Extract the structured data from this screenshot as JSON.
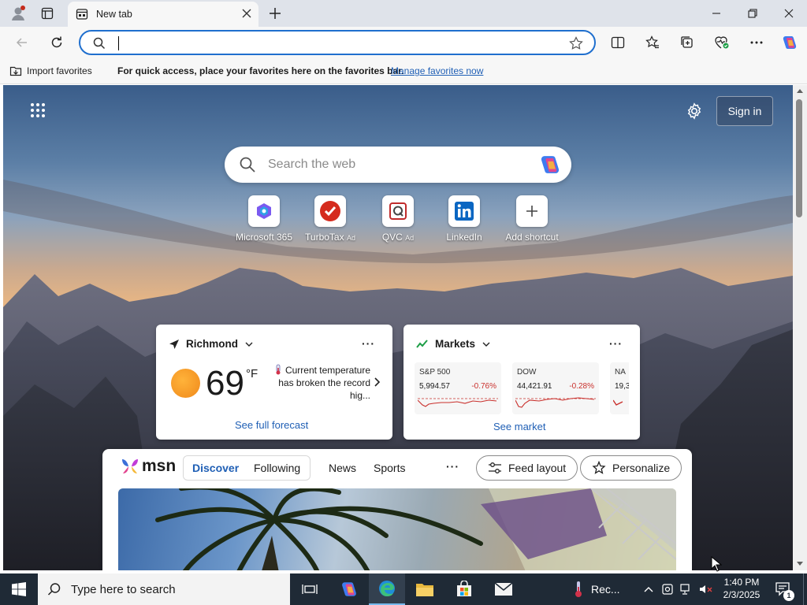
{
  "browser": {
    "tab": {
      "title": "New tab"
    },
    "favorites_bar": {
      "import_label": "Import favorites",
      "message": "For quick access, place your favorites here on the favorites bar.",
      "link": "Manage favorites now"
    }
  },
  "newtab": {
    "sign_in": "Sign in",
    "search_placeholder": "Search the web",
    "shortcuts": [
      {
        "label": "Microsoft 365",
        "ad": ""
      },
      {
        "label": "TurboTax",
        "ad": "Ad"
      },
      {
        "label": "QVC",
        "ad": "Ad"
      },
      {
        "label": "LinkedIn",
        "ad": ""
      },
      {
        "label": "Add shortcut",
        "ad": ""
      }
    ],
    "weather": {
      "location": "Richmond",
      "temperature": "69",
      "unit": "°F",
      "alert": "Current temperature has broken the record hig...",
      "link": "See full forecast"
    },
    "markets": {
      "title": "Markets",
      "tickers": [
        {
          "name": "S&P 500",
          "value": "5,994.57",
          "change": "-0.76%"
        },
        {
          "name": "DOW",
          "value": "44,421.91",
          "change": "-0.28%"
        },
        {
          "name": "NA",
          "value": "19,3",
          "change": ""
        }
      ],
      "link": "See market"
    },
    "msn": {
      "logo": "msn",
      "tabs": [
        "Discover",
        "Following",
        "News",
        "Sports"
      ],
      "feed_layout": "Feed layout",
      "personalize": "Personalize"
    }
  },
  "taskbar": {
    "search_placeholder": "Type here to search",
    "weather_app_label": "Rec...",
    "time": "1:40 PM",
    "date": "2/3/2025",
    "notification_count": "1"
  },
  "colors": {
    "accent": "#1f6fce",
    "link": "#1f5fb5",
    "negative": "#c9302c",
    "taskbar": "#1f2a36"
  }
}
